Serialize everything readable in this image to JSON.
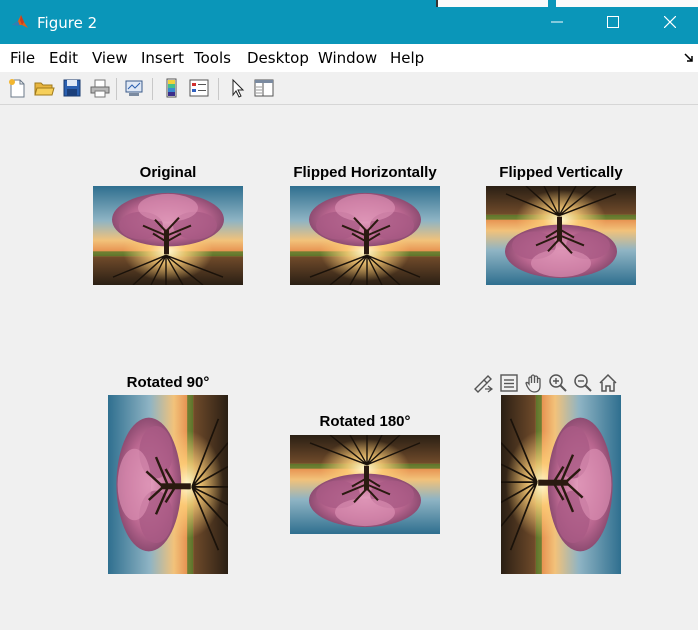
{
  "window": {
    "title": "Figure 2"
  },
  "menu": [
    "File",
    "Edit",
    "View",
    "Insert",
    "Tools",
    "Desktop",
    "Window",
    "Help"
  ],
  "toolbar": [
    "new-figure-icon",
    "open-file-icon",
    "save-icon",
    "print-icon",
    "link-plot-icon",
    "insert-colorbar-icon",
    "insert-legend-icon",
    "edit-plot-icon",
    "property-inspector-icon"
  ],
  "axes_toolbar": [
    "brush-icon",
    "data-tips-icon",
    "pan-icon",
    "zoom-in-icon",
    "zoom-out-icon",
    "restore-view-icon"
  ],
  "subplots": {
    "original": "Original",
    "flip_h": "Flipped Horizontally",
    "flip_v": "Flipped Vertically",
    "rot90": "Rotated 90°",
    "rot180": "Rotated 180°"
  },
  "colors": {
    "titlebar": "#0a96b9",
    "figure_bg": "#f0f0f0",
    "sky_top": "#2f6f8f",
    "sun": "#fff2b0",
    "blossom": "#c8739a",
    "ground": "#2c3a1c"
  }
}
